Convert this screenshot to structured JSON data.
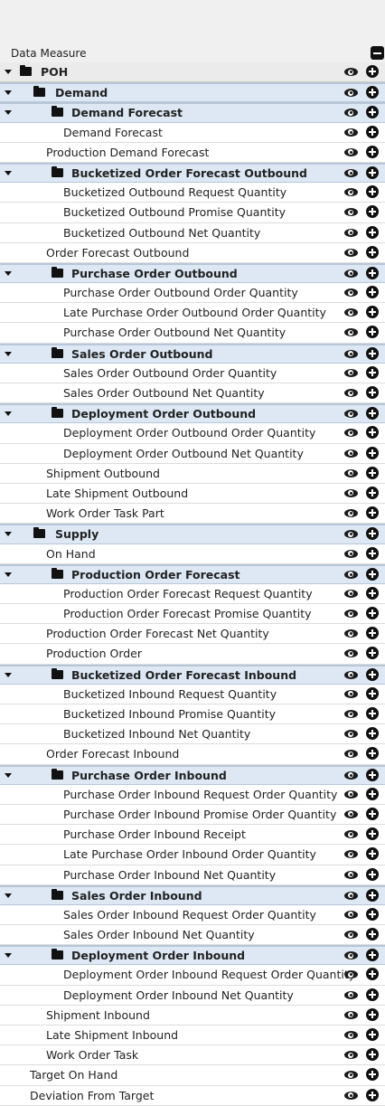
{
  "header": {
    "title": "Data Measure"
  },
  "rows": [
    {
      "label": "POH",
      "level": 0,
      "type": "root"
    },
    {
      "label": "Demand",
      "level": 1,
      "type": "group"
    },
    {
      "label": "Demand Forecast",
      "level": 2,
      "type": "group"
    },
    {
      "label": "Demand Forecast",
      "level": 3,
      "type": "item"
    },
    {
      "label": "Production Demand Forecast",
      "level": 2,
      "type": "item"
    },
    {
      "label": "Bucketized Order Forecast Outbound",
      "level": 2,
      "type": "group"
    },
    {
      "label": "Bucketized Outbound Request Quantity",
      "level": 3,
      "type": "item"
    },
    {
      "label": "Bucketized Outbound Promise Quantity",
      "level": 3,
      "type": "item"
    },
    {
      "label": "Bucketized Outbound Net Quantity",
      "level": 3,
      "type": "item"
    },
    {
      "label": "Order Forecast Outbound",
      "level": 2,
      "type": "item"
    },
    {
      "label": "Purchase Order Outbound",
      "level": 2,
      "type": "group"
    },
    {
      "label": "Purchase Order Outbound Order Quantity",
      "level": 3,
      "type": "item"
    },
    {
      "label": "Late Purchase Order Outbound Order Quantity",
      "level": 3,
      "type": "item"
    },
    {
      "label": "Purchase Order Outbound Net Quantity",
      "level": 3,
      "type": "item"
    },
    {
      "label": "Sales Order Outbound",
      "level": 2,
      "type": "group"
    },
    {
      "label": "Sales Order Outbound Order Quantity",
      "level": 3,
      "type": "item"
    },
    {
      "label": "Sales Order Outbound Net Quantity",
      "level": 3,
      "type": "item"
    },
    {
      "label": "Deployment Order Outbound",
      "level": 2,
      "type": "group"
    },
    {
      "label": "Deployment Order Outbound Order Quantity",
      "level": 3,
      "type": "item"
    },
    {
      "label": "Deployment Order Outbound Net Quantity",
      "level": 3,
      "type": "item"
    },
    {
      "label": "Shipment Outbound",
      "level": 2,
      "type": "item"
    },
    {
      "label": "Late Shipment Outbound",
      "level": 2,
      "type": "item"
    },
    {
      "label": "Work Order Task Part",
      "level": 2,
      "type": "item"
    },
    {
      "label": "Supply",
      "level": 1,
      "type": "group"
    },
    {
      "label": "On Hand",
      "level": 2,
      "type": "item"
    },
    {
      "label": "Production Order Forecast",
      "level": 2,
      "type": "group"
    },
    {
      "label": "Production Order Forecast Request Quantity",
      "level": 3,
      "type": "item"
    },
    {
      "label": "Production Order Forecast Promise Quantity",
      "level": 3,
      "type": "item"
    },
    {
      "label": "Production Order Forecast Net Quantity",
      "level": 2,
      "type": "item"
    },
    {
      "label": "Production Order",
      "level": 2,
      "type": "item"
    },
    {
      "label": "Bucketized Order Forecast Inbound",
      "level": 2,
      "type": "group"
    },
    {
      "label": "Bucketized Inbound Request Quantity",
      "level": 3,
      "type": "item"
    },
    {
      "label": "Bucketized Inbound Promise Quantity",
      "level": 3,
      "type": "item"
    },
    {
      "label": "Bucketized Inbound Net Quantity",
      "level": 3,
      "type": "item"
    },
    {
      "label": "Order Forecast Inbound",
      "level": 2,
      "type": "item"
    },
    {
      "label": "Purchase Order Inbound",
      "level": 2,
      "type": "group"
    },
    {
      "label": "Purchase Order Inbound Request Order Quantity",
      "level": 3,
      "type": "item"
    },
    {
      "label": "Purchase Order Inbound Promise Order Quantity",
      "level": 3,
      "type": "item"
    },
    {
      "label": "Purchase Order Inbound Receipt",
      "level": 3,
      "type": "item"
    },
    {
      "label": "Late Purchase Order Inbound Order Quantity",
      "level": 3,
      "type": "item"
    },
    {
      "label": "Purchase Order Inbound Net Quantity",
      "level": 3,
      "type": "item"
    },
    {
      "label": "Sales Order Inbound",
      "level": 2,
      "type": "group"
    },
    {
      "label": "Sales Order Inbound Request Order Quantity",
      "level": 3,
      "type": "item"
    },
    {
      "label": "Sales Order Inbound Net Quantity",
      "level": 3,
      "type": "item"
    },
    {
      "label": "Deployment Order Inbound",
      "level": 2,
      "type": "group"
    },
    {
      "label": "Deployment Order Inbound Request Order Quantity",
      "level": 3,
      "type": "item"
    },
    {
      "label": "Deployment Order Inbound Net Quantity",
      "level": 3,
      "type": "item"
    },
    {
      "label": "Shipment Inbound",
      "level": 2,
      "type": "item"
    },
    {
      "label": "Late Shipment Inbound",
      "level": 2,
      "type": "item"
    },
    {
      "label": "Work Order Task",
      "level": 2,
      "type": "item"
    },
    {
      "label": "Target On Hand",
      "level": 1,
      "type": "item"
    },
    {
      "label": "Deviation From Target",
      "level": 1,
      "type": "item"
    }
  ]
}
